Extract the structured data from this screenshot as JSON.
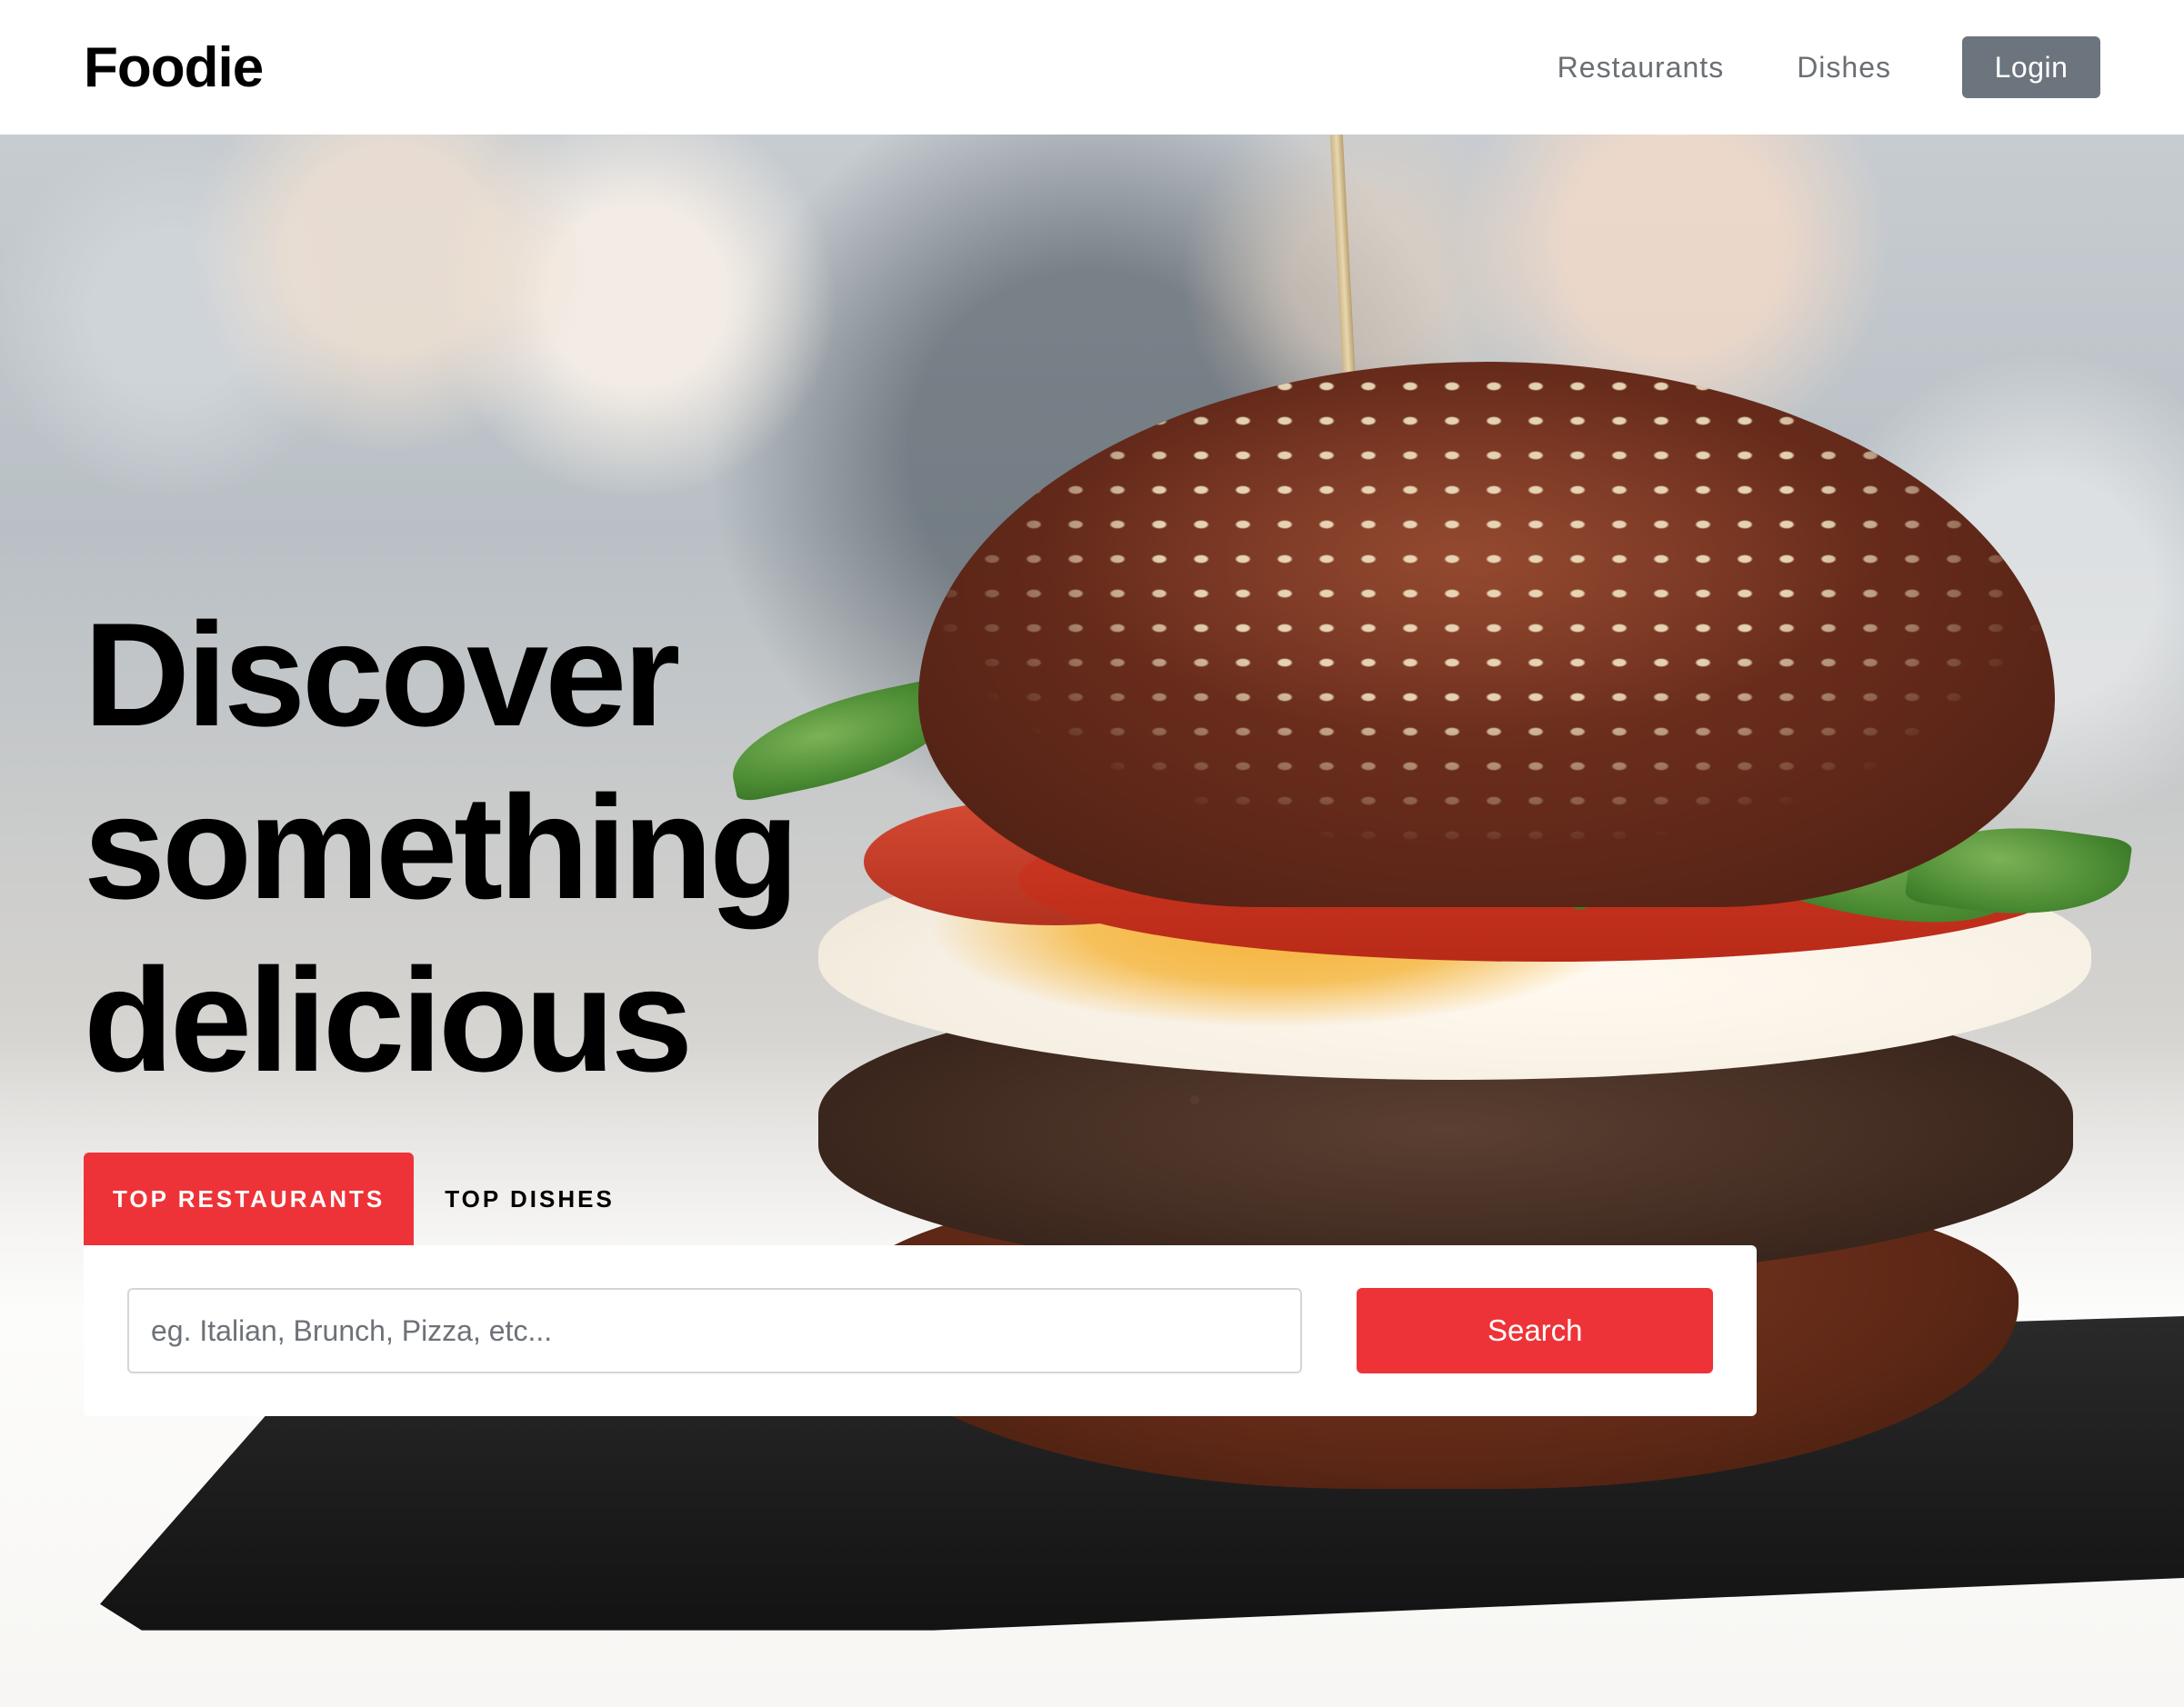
{
  "header": {
    "brand": "Foodie",
    "nav": [
      {
        "label": "Restaurants"
      },
      {
        "label": "Dishes"
      }
    ],
    "login_label": "Login"
  },
  "hero": {
    "headline": [
      "Discover",
      "something",
      "delicious"
    ],
    "tabs": [
      {
        "label": "TOP RESTAURANTS",
        "active": true
      },
      {
        "label": "TOP DISHES",
        "active": false
      }
    ],
    "search": {
      "placeholder": "eg. Italian, Brunch, Pizza, etc...",
      "value": "",
      "button_label": "Search"
    }
  },
  "colors": {
    "accent": "#ee3338",
    "login_button": "#6c757d",
    "nav_text": "#6b6f74"
  }
}
